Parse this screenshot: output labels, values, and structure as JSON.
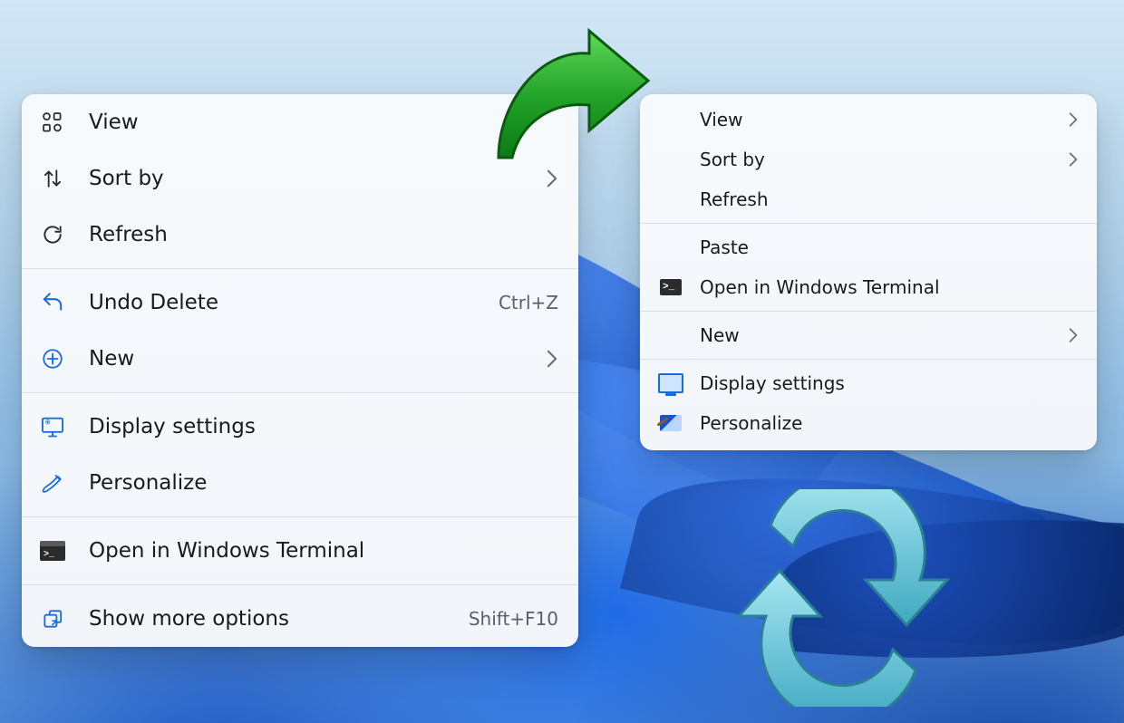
{
  "menuA": {
    "groups": [
      [
        {
          "icon": "view-icon",
          "label": "View",
          "hint": "",
          "sub": false
        },
        {
          "icon": "sort-icon",
          "label": "Sort by",
          "hint": "",
          "sub": true
        },
        {
          "icon": "refresh-icon",
          "label": "Refresh",
          "hint": "",
          "sub": false
        }
      ],
      [
        {
          "icon": "undo-icon",
          "label": "Undo Delete",
          "hint": "Ctrl+Z",
          "sub": false
        },
        {
          "icon": "new-icon",
          "label": "New",
          "hint": "",
          "sub": true
        }
      ],
      [
        {
          "icon": "display-icon",
          "label": "Display settings",
          "hint": "",
          "sub": false
        },
        {
          "icon": "personalize-icon",
          "label": "Personalize",
          "hint": "",
          "sub": false
        }
      ],
      [
        {
          "icon": "terminal-icon",
          "label": "Open in Windows Terminal",
          "hint": "",
          "sub": false
        }
      ],
      [
        {
          "icon": "more-icon",
          "label": "Show more options",
          "hint": "Shift+F10",
          "sub": false
        }
      ]
    ]
  },
  "menuB": {
    "groups": [
      [
        {
          "icon": "",
          "label": "View",
          "hint": "",
          "sub": true
        },
        {
          "icon": "",
          "label": "Sort by",
          "hint": "",
          "sub": true
        },
        {
          "icon": "",
          "label": "Refresh",
          "hint": "",
          "sub": false
        }
      ],
      [
        {
          "icon": "",
          "label": "Paste",
          "hint": "",
          "sub": false
        },
        {
          "icon": "terminal-icon-b",
          "label": "Open in Windows Terminal",
          "hint": "",
          "sub": false
        }
      ],
      [
        {
          "icon": "",
          "label": "New",
          "hint": "",
          "sub": true
        }
      ],
      [
        {
          "icon": "display-icon-b",
          "label": "Display settings",
          "hint": "",
          "sub": false
        },
        {
          "icon": "personalize-icon-b",
          "label": "Personalize",
          "hint": "",
          "sub": false
        }
      ]
    ]
  },
  "colors": {
    "arrow_green": "#24a52a",
    "sync_cyan": "#5bc7de"
  }
}
